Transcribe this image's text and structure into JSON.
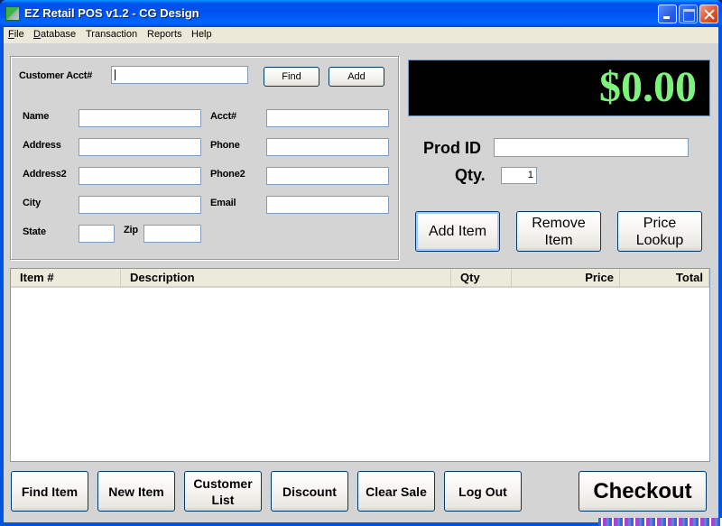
{
  "window": {
    "title": "EZ Retail POS v1.2 - CG Design",
    "icon": "app-icon",
    "controls": [
      "minimize-icon",
      "maximize-icon",
      "close-icon"
    ]
  },
  "menu": [
    {
      "label": "File",
      "accel": "F",
      "rest": "ile"
    },
    {
      "label": "Database",
      "accel": "D",
      "rest": "atabase"
    },
    {
      "label": "Transaction",
      "accel": "",
      "rest": "Transaction"
    },
    {
      "label": "Reports",
      "accel": "",
      "rest": "Reports"
    },
    {
      "label": "Help",
      "accel": "",
      "rest": "Help"
    }
  ],
  "customer": {
    "acct_label": "Customer Acct#",
    "acct_value": "",
    "find_label": "Find",
    "add_label": "Add",
    "fields": {
      "name": {
        "label": "Name",
        "value": ""
      },
      "acct": {
        "label": "Acct#",
        "value": ""
      },
      "address": {
        "label": "Address",
        "value": ""
      },
      "phone": {
        "label": "Phone",
        "value": ""
      },
      "address2": {
        "label": "Address2",
        "value": ""
      },
      "phone2": {
        "label": "Phone2",
        "value": ""
      },
      "city": {
        "label": "City",
        "value": ""
      },
      "email": {
        "label": "Email",
        "value": ""
      },
      "state": {
        "label": "State",
        "value": ""
      },
      "zip": {
        "label": "Zip",
        "value": ""
      }
    }
  },
  "total_display": {
    "amount": "$0.00",
    "color": "#7cf37a"
  },
  "product": {
    "prod_id_label": "Prod ID",
    "prod_id_value": "",
    "qty_label": "Qty.",
    "qty_value": "1"
  },
  "item_actions": {
    "add": "Add Item",
    "remove_line1": "Remove",
    "remove_line2": "Item",
    "lookup_line1": "Price",
    "lookup_line2": "Lookup"
  },
  "items_table": {
    "columns": [
      "Item #",
      "Description",
      "Qty",
      "Price",
      "Total"
    ],
    "rows": []
  },
  "bottom_buttons": {
    "find_item": "Find Item",
    "new_item": "New Item",
    "customer_list_line1": "Customer",
    "customer_list_line2": "List",
    "discount": "Discount",
    "clear_sale": "Clear Sale",
    "log_out": "Log Out",
    "checkout": "Checkout"
  }
}
